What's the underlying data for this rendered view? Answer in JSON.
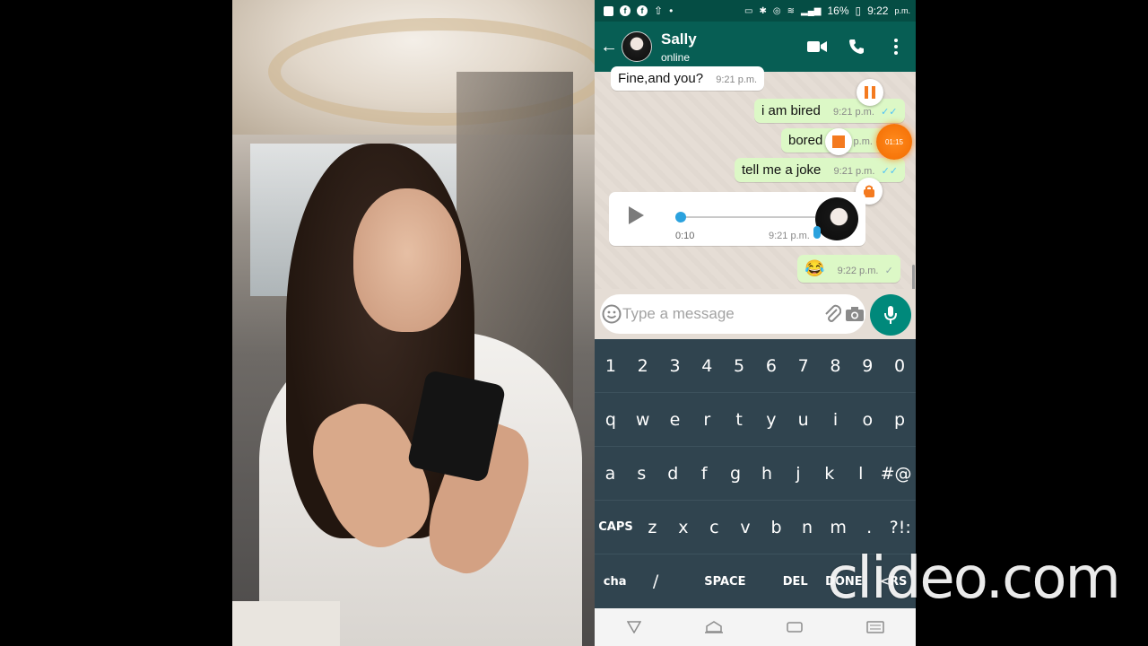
{
  "status_bar": {
    "battery": "16%",
    "time": "9:22",
    "ampm": "p.m."
  },
  "header": {
    "contact_name": "Sally",
    "contact_status": "online",
    "icons": [
      "back-arrow-icon",
      "video-call-icon",
      "phone-icon",
      "more-vert-icon"
    ]
  },
  "messages": [
    {
      "direction": "in",
      "text": "Fine,and you?",
      "time": "9:21 p.m."
    },
    {
      "direction": "out",
      "text": "i am bired",
      "time": "9:21 p.m.",
      "ticks": "✓✓"
    },
    {
      "direction": "out",
      "text": "bored",
      "time": "p.m.",
      "ticks": "✓✓"
    },
    {
      "direction": "out",
      "text": "tell me a joke",
      "time": "9:21 p.m.",
      "ticks": "✓✓"
    },
    {
      "direction": "in",
      "type": "voice",
      "duration": "0:10",
      "time": "9:21 p.m."
    },
    {
      "direction": "out",
      "text": "😂",
      "time": "9:22 p.m.",
      "ticks": "✓"
    }
  ],
  "recorder": {
    "timer": "01:15"
  },
  "composer": {
    "placeholder": "Type a message"
  },
  "keyboard": {
    "rows": [
      [
        "1",
        "2",
        "3",
        "4",
        "5",
        "6",
        "7",
        "8",
        "9",
        "0"
      ],
      [
        "q",
        "w",
        "e",
        "r",
        "t",
        "y",
        "u",
        "i",
        "o",
        "p"
      ],
      [
        "a",
        "s",
        "d",
        "f",
        "g",
        "h",
        "j",
        "k",
        "l",
        "#@"
      ],
      [
        "CAPS",
        "z",
        "x",
        "c",
        "v",
        "b",
        "n",
        "m",
        ".",
        "?!:"
      ],
      [
        "cha",
        "/",
        "SPACE",
        "DEL",
        "DONE",
        "<RS"
      ]
    ]
  },
  "watermark": "clideo.com",
  "colors": {
    "header": "#075e54",
    "status_bar": "#054d44",
    "outgoing_bubble": "#dcf8c6",
    "incoming_bubble": "#ffffff",
    "mic_button": "#00897b",
    "keyboard": "#30444f",
    "recorder": "#f26b00"
  }
}
